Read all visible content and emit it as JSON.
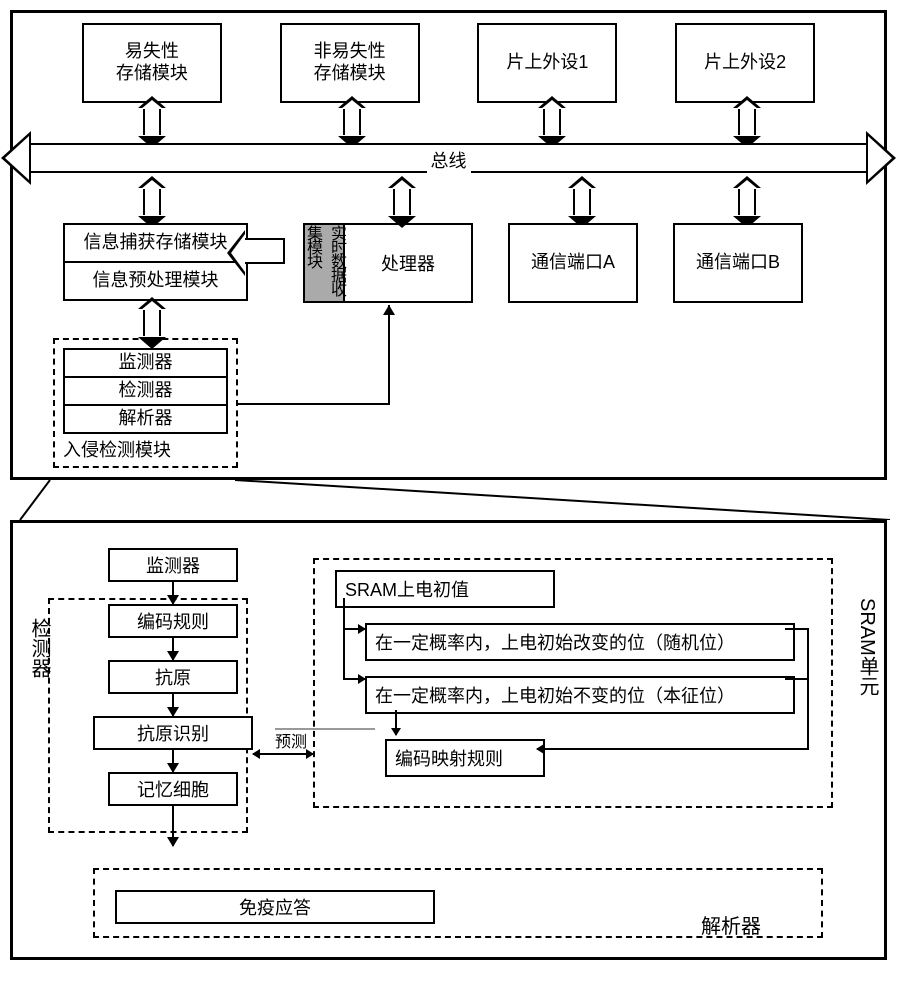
{
  "upper": {
    "top_blocks": [
      "易失性\n存储模块",
      "非易失性\n存储模块",
      "片上外设1",
      "片上外设2"
    ],
    "bus": "总线",
    "capture": "信息捕获存储模块",
    "preprocess": "信息预处理模块",
    "realtime": "实时数据收集模块",
    "processor": "处理器",
    "commA": "通信端口A",
    "commB": "通信端口B",
    "intrusion": {
      "monitor": "监测器",
      "detector": "检测器",
      "parser": "解析器",
      "label": "入侵检测模块"
    }
  },
  "lower": {
    "monitor": "监测器",
    "encode_rule": "编码规则",
    "antigen": "抗原",
    "antigen_rec": "抗原识别",
    "memory_cell": "记忆细胞",
    "immune": "免疫应答",
    "detector_label": "检测器",
    "parser_label": "解析器",
    "predict": "预测",
    "sram": {
      "title": "SRAM上电初值",
      "row1": "在一定概率内，上电初始改变的位（随机位）",
      "row2": "在一定概率内，上电初始不变的位（本征位）",
      "map": "编码映射规则",
      "unit": "SRAM单元"
    }
  }
}
